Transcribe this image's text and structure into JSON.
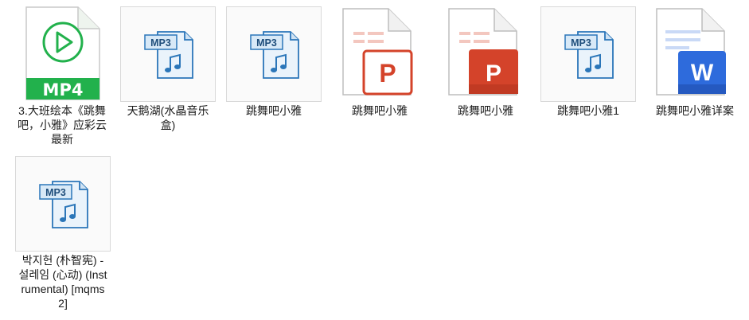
{
  "files": [
    {
      "name": "3.大班绘本《跳舞吧，小雅》应彩云最新",
      "type": "mp4",
      "badge": "MP4"
    },
    {
      "name": "天鹅湖(水晶音乐盒)",
      "type": "mp3",
      "badge": "MP3"
    },
    {
      "name": "跳舞吧小雅",
      "type": "mp3",
      "badge": "MP3"
    },
    {
      "name": "跳舞吧小雅",
      "type": "pptx",
      "badge": "P"
    },
    {
      "name": "跳舞吧小雅",
      "type": "ppt",
      "badge": "P"
    },
    {
      "name": "跳舞吧小雅1",
      "type": "mp3",
      "badge": "MP3"
    },
    {
      "name": "跳舞吧小雅详案",
      "type": "docx",
      "badge": "W"
    },
    {
      "name": "박지헌 (朴智宪) - 설레임 (心动) (Instrumental) [mqms2]",
      "type": "mp3",
      "badge": "MP3"
    }
  ],
  "colors": {
    "mp4_green": "#22b14c",
    "mp3_blue": "#2b76b9",
    "ppt_red": "#d4432a",
    "word_blue": "#2e6bdc"
  }
}
